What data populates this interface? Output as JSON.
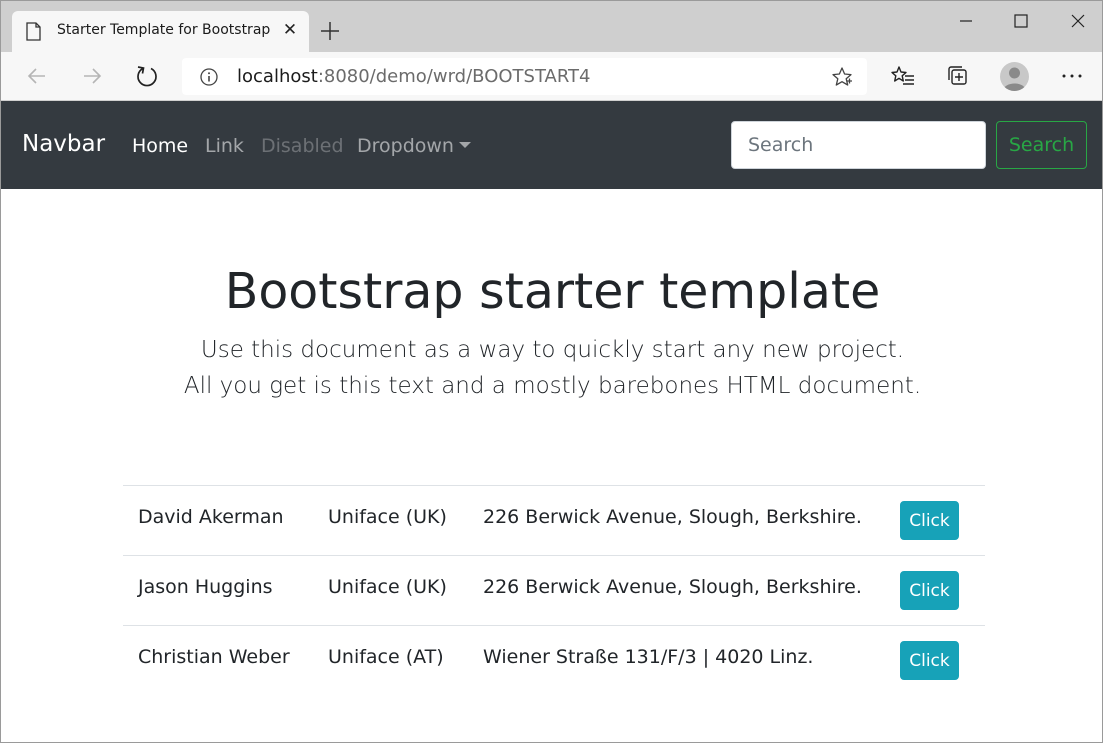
{
  "browser": {
    "tab_title": "Starter Template for Bootstrap",
    "tab_close": "✕",
    "url_host": "localhost",
    "url_rest": ":8080/demo/wrd/BOOTSTART4"
  },
  "navbar": {
    "brand": "Navbar",
    "links": [
      {
        "label": "Home",
        "state": "active"
      },
      {
        "label": "Link",
        "state": "normal"
      },
      {
        "label": "Disabled",
        "state": "disabled"
      },
      {
        "label": "Dropdown",
        "state": "dropdown"
      }
    ],
    "search_placeholder": "Search",
    "search_button": "Search"
  },
  "hero": {
    "title": "Bootstrap starter template",
    "lead_line1": "Use this document as a way to quickly start any new project.",
    "lead_line2": "All you get is this text and a mostly barebones HTML document."
  },
  "table": {
    "rows": [
      {
        "name": "David Akerman",
        "company": "Uniface (UK)",
        "address": "226 Berwick Avenue, Slough, Berkshire.",
        "button": "Click"
      },
      {
        "name": "Jason Huggins",
        "company": "Uniface (UK)",
        "address": "226 Berwick Avenue, Slough, Berkshire.",
        "button": "Click"
      },
      {
        "name": "Christian Weber",
        "company": "Uniface (AT)",
        "address": "Wiener Straße 131/F/3 | 4020 Linz.",
        "button": "Click"
      }
    ]
  },
  "colors": {
    "navbar_bg": "#343a40",
    "search_outline": "#28a745",
    "info_button": "#17a2b8"
  }
}
